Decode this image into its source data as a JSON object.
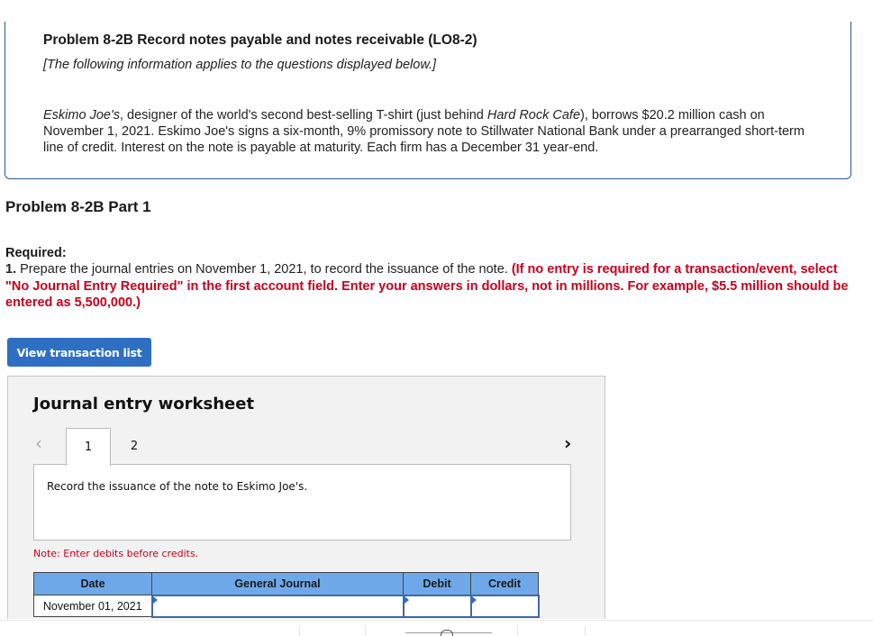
{
  "problem": {
    "title": "Problem 8-2B Record notes payable and notes receivable (LO8-2)",
    "subtitle": "[The following information applies to the questions displayed below.]",
    "body": {
      "company_italic": "Eskimo Joe's",
      "part1": ", designer of the world's second best-selling T-shirt (just behind ",
      "competitor_italic": "Hard Rock Cafe",
      "part2": "), borrows $20.2 million cash on November 1, 2021. Eskimo Joe's signs a six-month, 9% promissory note to Stillwater National Bank under a prearranged short-term line of credit. Interest on the note is payable at maturity. Each firm has a December 31 year-end."
    }
  },
  "part": {
    "title": "Problem 8-2B Part 1",
    "required_label": "Required:",
    "required_number": "1.",
    "required_text": " Prepare the journal entries on November 1, 2021, to record the issuance of the note. ",
    "required_instruction": "(If no entry is required for a transaction/event, select \"No Journal Entry Required\" in the first account field. Enter your answers in dollars, not in millions. For example, $5.5 million should be entered as 5,500,000.)"
  },
  "buttons": {
    "view_transaction_list": "View transaction list"
  },
  "worksheet": {
    "title": "Journal entry worksheet",
    "nav_prev_icon": "chevron-left-icon",
    "nav_next_icon": "chevron-right-icon",
    "tabs": [
      {
        "label": "1",
        "active": true
      },
      {
        "label": "2",
        "active": false
      }
    ],
    "description": "Record the issuance of the note to Eskimo Joe's.",
    "note": "Note: Enter debits before credits.",
    "table": {
      "headers": [
        "Date",
        "General Journal",
        "Debit",
        "Credit"
      ],
      "rows": [
        {
          "date": "November 01, 2021",
          "account": "",
          "debit": "",
          "credit": ""
        }
      ]
    }
  },
  "colors": {
    "accent_blue": "#2e6fc4",
    "header_blue": "#6fa8e8",
    "instruction_red": "#c8001e"
  }
}
